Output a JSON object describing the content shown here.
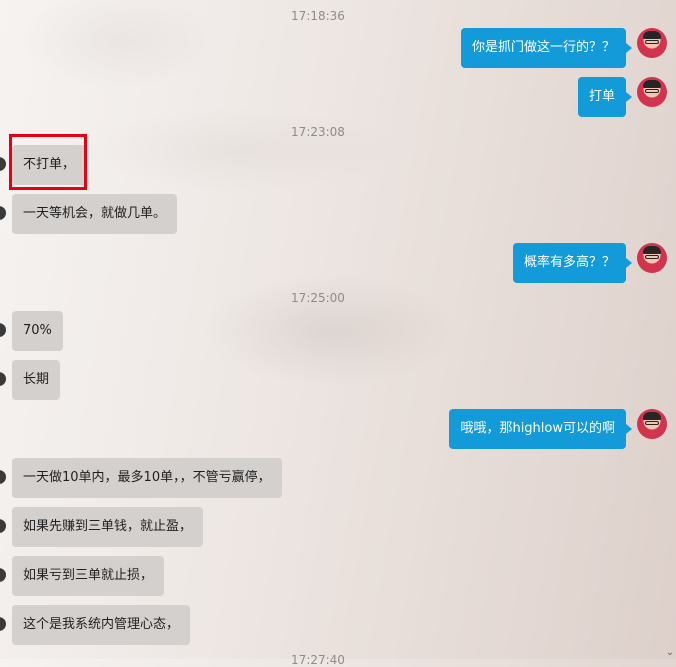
{
  "chat": {
    "timestamps": [
      "17:18:36",
      "17:23:08",
      "17:25:00",
      "17:27:40"
    ],
    "messages": [
      {
        "text": "你是抓门做这一行的？？"
      },
      {
        "text": "打单"
      },
      {
        "text": "不打单，"
      },
      {
        "text": "一天等机会，就做几单。"
      },
      {
        "text": "概率有多高？？"
      },
      {
        "text": "70%"
      },
      {
        "text": "长期"
      },
      {
        "text": "哦哦，那highlow可以的啊"
      },
      {
        "text": "一天做10单内，最多10单，，不管亏赢停，"
      },
      {
        "text": "如果先赚到三单钱，就止盈，"
      },
      {
        "text": "如果亏到三单就止损，"
      },
      {
        "text": "这个是我系统内管理心态，"
      }
    ]
  },
  "colors": {
    "outgoing_bubble": "#129bd8",
    "incoming_bubble": "#d4d0cd",
    "highlight_box": "#e60012"
  },
  "icons": {
    "user_avatar": "avatar-icon",
    "scroll": "chevron-down-icon"
  }
}
